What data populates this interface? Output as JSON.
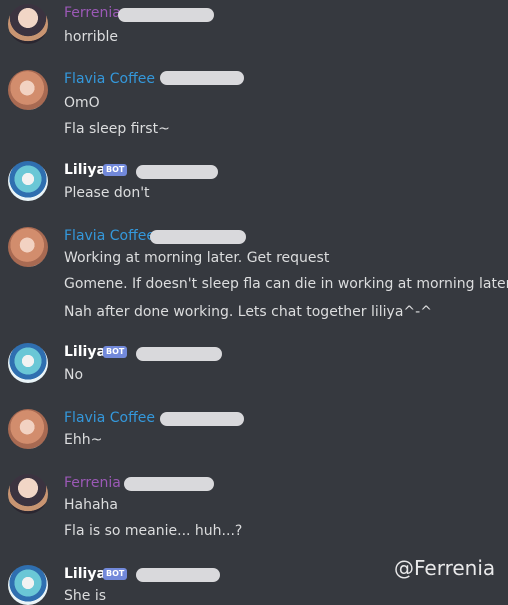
{
  "users": {
    "ferrenia": {
      "name": "Ferrenia",
      "color": "#9b59b6"
    },
    "flavia": {
      "name": "Flavia Coffee",
      "color": "#3498db"
    },
    "liliya": {
      "name": "Liliya",
      "color": "#ffffff",
      "badge": "BOT"
    }
  },
  "messages": [
    {
      "lines": [
        "horrible"
      ]
    },
    {
      "lines": [
        "OmO",
        "Fla sleep first~"
      ]
    },
    {
      "lines": [
        "Please don't"
      ]
    },
    {
      "lines": [
        "Working at morning later. Get request",
        "Gomene. If doesn't sleep fla can die in working at morning later",
        "Nah after done working. Lets chat together liliya^-^"
      ]
    },
    {
      "lines": [
        "No"
      ]
    },
    {
      "lines": [
        "Ehh~"
      ]
    },
    {
      "lines": [
        "Hahaha",
        "Fla is so meanie...  huh...?"
      ]
    },
    {
      "lines": [
        "She is"
      ]
    }
  ],
  "watermark": "@Ferrenia"
}
